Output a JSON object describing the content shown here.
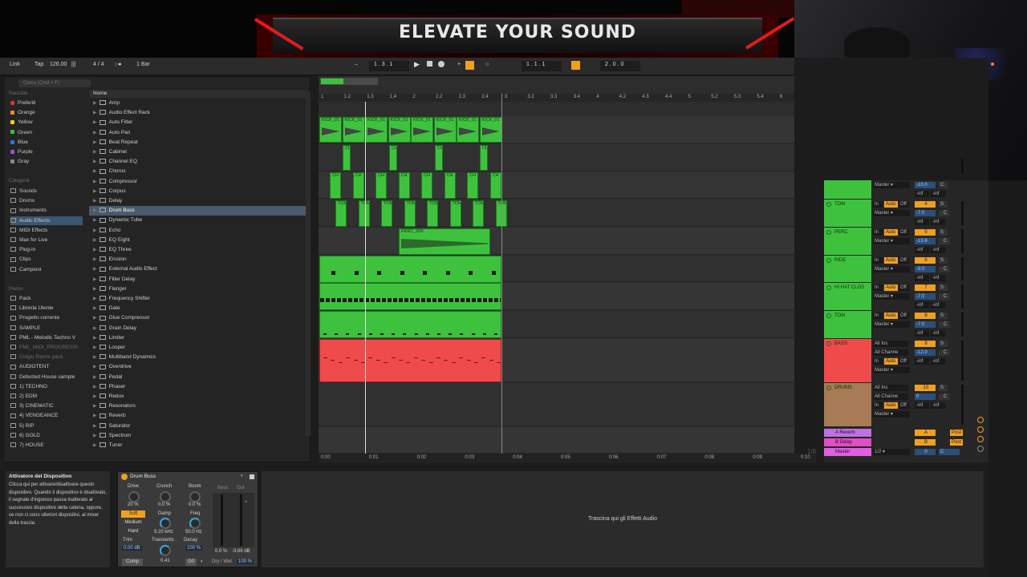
{
  "banner": {
    "title": "ELEVATE YOUR SOUND"
  },
  "transport": {
    "link": "Link",
    "tap": "Tap",
    "tempo": "126.00",
    "meter_icon": "|||",
    "signature": "4 / 4",
    "metronome": "○●",
    "quantize": "1 Bar",
    "position": "1 .   3 .   1",
    "loop_start": "1 .   1 .   1",
    "loop_length": "2 .   0 .   0"
  },
  "browser": {
    "search_placeholder": "Cerca (Cmd + F)",
    "collections_header": "Raccolte",
    "collections": [
      {
        "label": "Preferiti",
        "color": "#e03030"
      },
      {
        "label": "Orange",
        "color": "#f08a20"
      },
      {
        "label": "Yellow",
        "color": "#e8d020"
      },
      {
        "label": "Green",
        "color": "#40c040"
      },
      {
        "label": "Blue",
        "color": "#3070e0"
      },
      {
        "label": "Purple",
        "color": "#a050d0"
      },
      {
        "label": "Gray",
        "color": "#8a8a8a"
      }
    ],
    "categories_header": "Categorie",
    "categories": [
      "Sounds",
      "Drums",
      "Instruments",
      "Audio Effects",
      "MIDI Effects",
      "Max for Live",
      "Plug-in",
      "Clips",
      "Campioni"
    ],
    "places_header": "Places",
    "places": [
      "Pack",
      "Libreria Utente",
      "Progetto corrente",
      "SAMPLE",
      "PML - Melodic Techno V",
      "PML_MIDI_PROGRESSI",
      "Colgio-Remix pack",
      "AUDIOTENT",
      "Defected House sample",
      "1) TECHNO",
      "2) EDM",
      "3) CINEMATIC",
      "4) VENGEANCE",
      "5) RIP",
      "6) GOLD",
      "7) HOUSE"
    ],
    "list_header": "Nome",
    "items": [
      "Amp",
      "Audio Effect Rack",
      "Auto Filter",
      "Auto Pan",
      "Beat Repeat",
      "Cabinet",
      "Channel EQ",
      "Chorus",
      "Compressor",
      "Corpus",
      "Delay",
      "Drum Buss",
      "Dynamic Tube",
      "Echo",
      "EQ Eight",
      "EQ Three",
      "Erosion",
      "External Audio Effect",
      "Filter Delay",
      "Flanger",
      "Frequency Shifter",
      "Gate",
      "Glue Compressor",
      "Grain Delay",
      "Limiter",
      "Looper",
      "Multiband Dynamics",
      "Overdrive",
      "Pedal",
      "Phaser",
      "Redux",
      "Resonators",
      "Reverb",
      "Saturator",
      "Spectrum",
      "Tuner"
    ],
    "selected_item": "Drum Buss"
  },
  "ruler": [
    "1",
    "1.2",
    "1.3",
    "1.4",
    "2",
    "2.2",
    "2.3",
    "2.4",
    "3",
    "3.2",
    "3.3",
    "3.4",
    "4",
    "4.2",
    "4.3",
    "4.4",
    "5",
    "5.2",
    "5.3",
    "5.4",
    "6"
  ],
  "clips": {
    "kick": "KICK_01",
    "clap": "CL",
    "hat": "CH",
    "tom": "TOM",
    "perc": "PERC_008"
  },
  "timeline": [
    "0:00",
    "0:01",
    "0:02",
    "0:03",
    "0:04",
    "0:05",
    "0:06",
    "0:07",
    "0:08",
    "0:09",
    "0:10"
  ],
  "zoom_fraction": "1/8",
  "mixer": {
    "output": "Master",
    "in": "In",
    "auto": "Auto",
    "off": "Off",
    "solo": "S",
    "center": "C",
    "inf": "-inf",
    "all_ins": "All Ins",
    "all_channels": "All Channe",
    "tracks": [
      {
        "name": "",
        "num": "",
        "vol": "-10.0",
        "color": "#3ec23e"
      },
      {
        "name": "TOM",
        "num": "4",
        "vol": "-7.0",
        "color": "#3ec23e"
      },
      {
        "name": "PERC",
        "num": "5",
        "vol": "-13.8",
        "color": "#3ec23e"
      },
      {
        "name": "RIDE",
        "num": "6",
        "vol": "-9.0",
        "color": "#3ec23e"
      },
      {
        "name": "HI HAT CLOS",
        "num": "7",
        "vol": "-7.0",
        "color": "#3ec23e"
      },
      {
        "name": "TOM",
        "num": "8",
        "vol": "-7.0",
        "color": "#3ec23e"
      },
      {
        "name": "BASS",
        "num": "9",
        "vol": "-12.0",
        "color": "#ef4b4b"
      },
      {
        "name": "DRUMS",
        "num": "10",
        "vol": "0",
        "color": "#a67b55"
      }
    ],
    "returns": [
      {
        "name": "A Reverb",
        "btn": "A",
        "color": "#c070e0"
      },
      {
        "name": "B Delay",
        "btn": "B",
        "color": "#e050c0"
      },
      {
        "name": "Master",
        "btn": "0",
        "color": "#e060e0"
      }
    ],
    "post": "Post",
    "master_fraction": "1/2"
  },
  "info": {
    "title": "Attivatore del Dispositivo",
    "text": "Clicca qui per attivare/disattivare questo dispositivo. Quando il dispositivo è disattivato, il segnale d'ingresso passa inalterato al successivo dispositivo della catena, oppure, se non ci sono ulteriori dispositivi, al mixer della traccia."
  },
  "device": {
    "title": "Drum Buss",
    "drive_label": "Drive",
    "drive_val": "20 %",
    "crunch_label": "Crunch",
    "crunch_val": "0.0 %",
    "boom_label": "Boom",
    "boom_val": "0.0 %",
    "bass_label": "Bass",
    "out_label": "Out",
    "mode_soft": "Soft",
    "mode_medium": "Medium",
    "mode_hard": "Hard",
    "damp_label": "Damp",
    "damp_val": "9.20 kHz",
    "freq_label": "Freq",
    "freq_val": "50.0 Hz",
    "trim_label": "Trim",
    "trim_val": "0.00 dB",
    "transients_label": "Transients",
    "transients_val": "0.41",
    "decay_label": "Decay",
    "decay_val": "100 %",
    "bass_val": "0.0 %",
    "out_val": "-3.66 dB",
    "comp": "Comp",
    "go": "G0",
    "drywet_label": "Dry / Wet",
    "drywet_val": "100 %"
  },
  "drop_hint": "Trascina qui gli Effetti Audio"
}
